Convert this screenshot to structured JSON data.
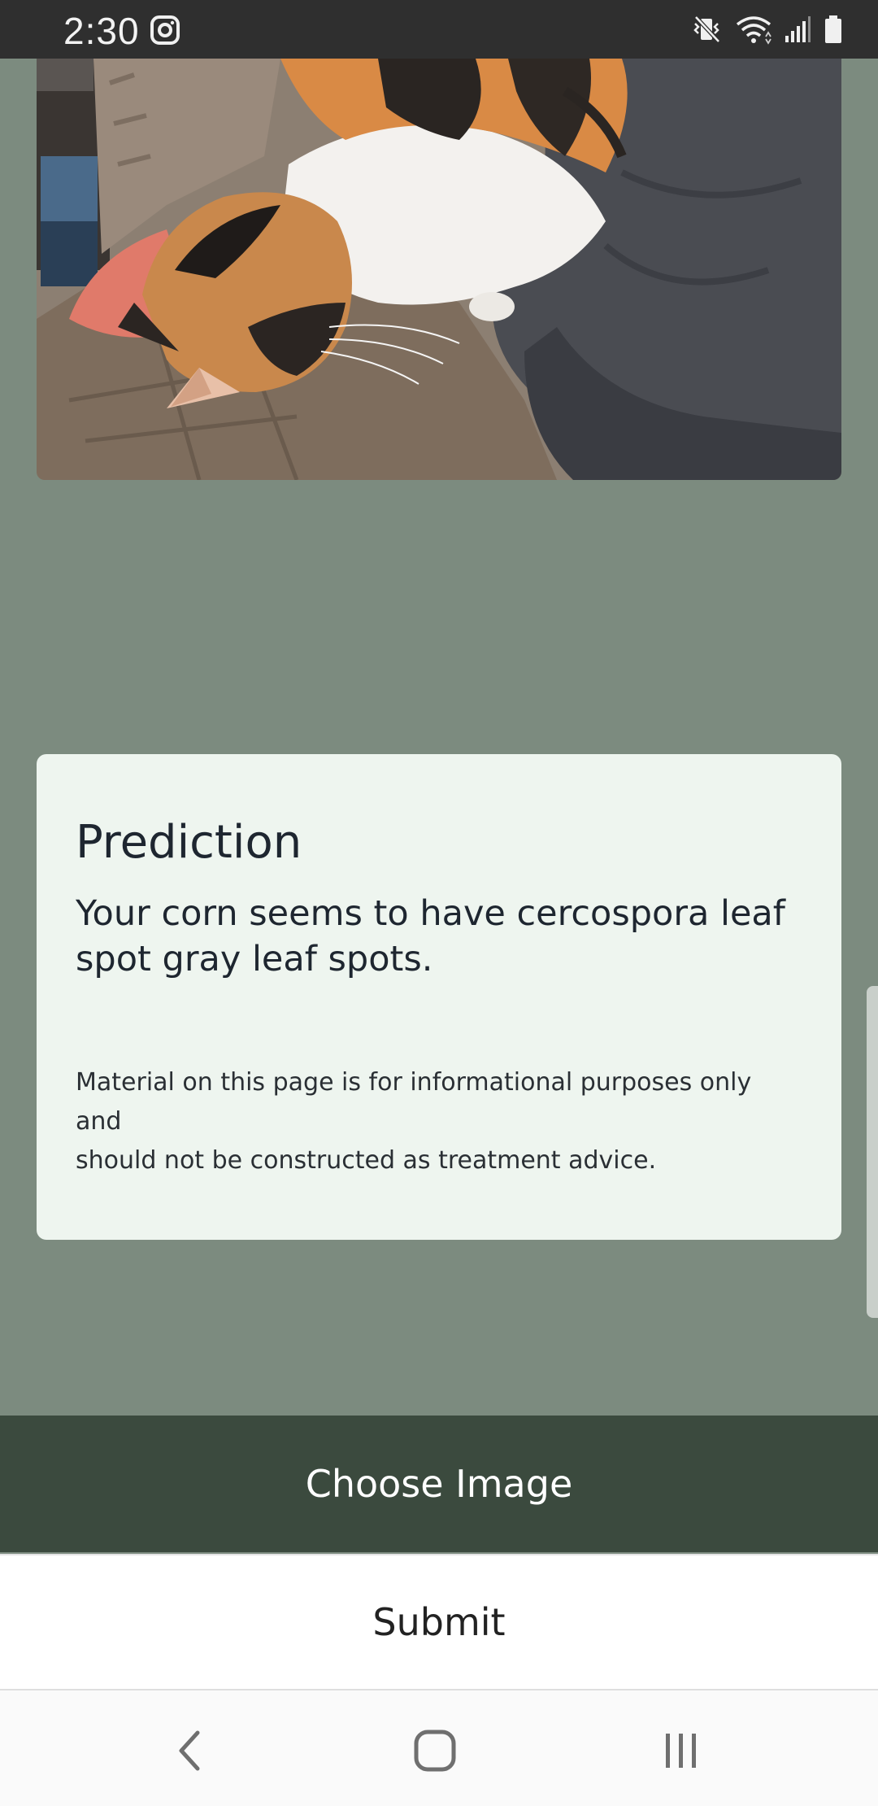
{
  "status_bar": {
    "time": "2:30",
    "icons": [
      "instagram-icon",
      "vibrate-mute-icon",
      "wifi-icon",
      "signal-icon",
      "battery-icon"
    ]
  },
  "photo": {
    "subject": "cat-photo"
  },
  "prediction": {
    "title": "Prediction",
    "result": "Your corn seems to have cercospora leaf spot gray leaf spots.",
    "disclaimer_line1": "Material on this page is for informational purposes only",
    "disclaimer_line2": "and",
    "disclaimer_line3": "should not be constructed as treatment advice."
  },
  "actions": {
    "choose_label": "Choose Image",
    "submit_label": "Submit"
  },
  "nav": {
    "icons": [
      "back-icon",
      "home-icon",
      "recents-icon"
    ]
  },
  "colors": {
    "page_background": "#7c8b7f",
    "card_background": "#eef5ef",
    "choose_button": "#3b4a3e",
    "status_bar": "#2f2f2f"
  }
}
